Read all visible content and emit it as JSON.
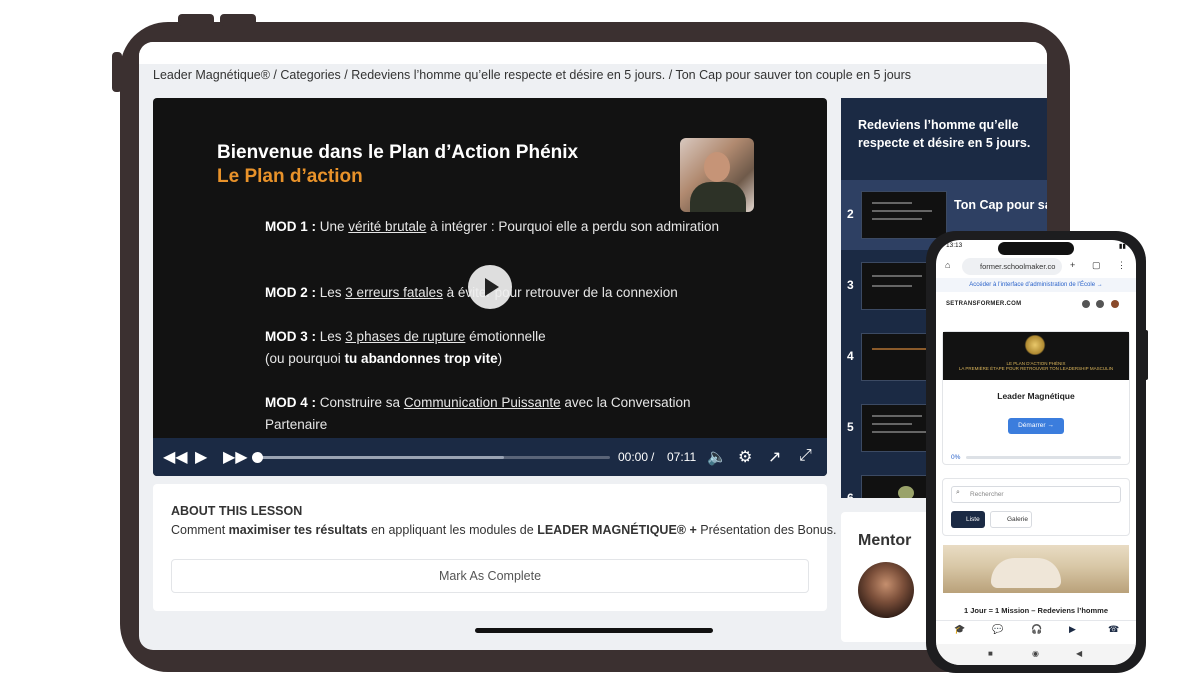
{
  "breadcrumb": "Leader Magnétique® / Categories / Redeviens l’homme qu’elle respecte et désire en 5 jours. / Ton Cap pour sauver ton couple en 5 jours",
  "video": {
    "title": "Bienvenue dans le Plan d’Action Phénix",
    "subtitle": "Le Plan d’action",
    "mods": [
      {
        "label": "MOD 1 :",
        "pre": " Une ",
        "u": "vérité brutale",
        "post": " à intégrer : Pourquoi elle a perdu son admiration"
      },
      {
        "label": "MOD 2 :",
        "pre": " Les ",
        "u": "3 erreurs fatales",
        "post": " à éviter pour retrouver de la connexion"
      },
      {
        "label": "MOD 3 :",
        "pre": " Les ",
        "u": "3 phases de rupture",
        "post": " émotionnelle",
        "line2_pre": "(ou pourquoi ",
        "line2_b": "tu abandonnes trop vite",
        "line2_post": ")"
      },
      {
        "label": "MOD 4 :",
        "pre": " Construire sa ",
        "u": "Communication Puissante",
        "post": " avec la Conversation Partenaire"
      }
    ],
    "current_time": "00:00",
    "separator": "/",
    "duration": "07:11",
    "progress": 0,
    "buffered": 0.7
  },
  "about": {
    "heading": "ABOUT THIS LESSON",
    "text_pre": "Comment ",
    "text_b1": "maximiser tes résultats",
    "text_mid": " en appliquant les modules de ",
    "text_b2": "LEADER MAGNÉTIQUE® +",
    "text_post": " Présentation des Bonus.",
    "mark_label": "Mark As Complete"
  },
  "playlist": {
    "title": "Redeviens l’homme qu’elle respecte et désire en 5 jours.",
    "items": [
      {
        "num": "2",
        "label": "Ton Cap pour sauver ton couple en 5 jours",
        "active": true
      },
      {
        "num": "3",
        "label": "",
        "active": false
      },
      {
        "num": "4",
        "label": "",
        "active": false
      },
      {
        "num": "5",
        "label": "",
        "active": false
      },
      {
        "num": "6",
        "label": "",
        "active": false
      }
    ]
  },
  "mentor": {
    "heading": "Mentor"
  },
  "phone": {
    "time": "13:13",
    "url": "former.schoolmaker.co",
    "admin_link": "Accéder à l’interface d’administration de l’École →",
    "site_name": "SETRANSFORMER.COM",
    "banner_title": "LE PLAN D’ACTION PHÉNIX",
    "banner_sub": "LA PREMIÈRE ÉTAPE POUR RETROUVER TON LEADERSHIP MASCULIN",
    "course_title": "Leader Magnétique",
    "start_label": "Démarrer →",
    "progress_label": "0%",
    "search_placeholder": "Rechercher",
    "list_label": "Liste",
    "gallery_label": "Galerie",
    "lesson_caption": "1 Jour = 1 Mission – Redeviens l’homme",
    "colors": {
      "accent": "#3b7ddd",
      "navy": "#1b2a44",
      "orange": "#e8922a"
    }
  }
}
